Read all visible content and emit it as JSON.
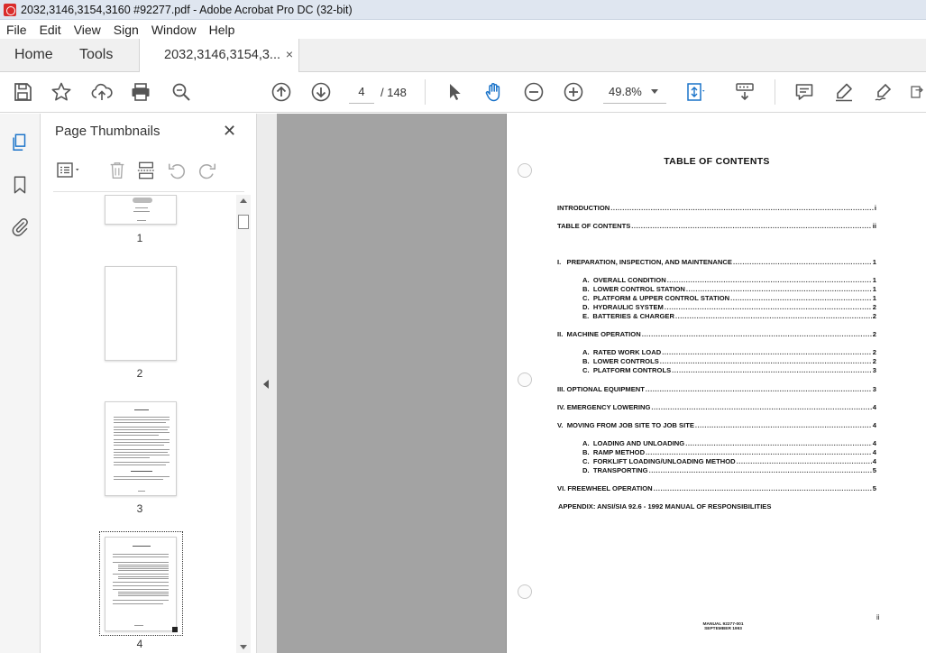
{
  "window": {
    "title": "2032,3146,3154,3160 #92277.pdf - Adobe Acrobat Pro DC (32-bit)"
  },
  "menu": [
    "File",
    "Edit",
    "View",
    "Sign",
    "Window",
    "Help"
  ],
  "tabs": {
    "home": "Home",
    "tools": "Tools",
    "document": "2032,3146,3154,3...",
    "close": "×"
  },
  "toolbar": {
    "current_page": "4",
    "page_total": "/ 148",
    "zoom": "49.8%",
    "icons": [
      "save-icon",
      "star-icon",
      "upload-icon",
      "print-icon",
      "zoom-search-icon",
      "page-up-icon",
      "page-down-icon",
      "select-cursor-icon",
      "hand-icon",
      "zoom-out-icon",
      "zoom-in-icon",
      "fit-page-icon",
      "keyboard-scroll-icon",
      "comment-icon",
      "highlight-pen-icon",
      "sign-icon",
      "more-tools-icon"
    ]
  },
  "left_rail": {
    "icons": [
      "page-thumbnails-icon",
      "bookmarks-icon",
      "attachments-icon"
    ]
  },
  "thumbnails_panel": {
    "title": "Page Thumbnails",
    "close": "✕",
    "pages": [
      "1",
      "2",
      "3",
      "4"
    ],
    "selected_page": "4"
  },
  "document": {
    "toc_title": "TABLE OF CONTENTS",
    "entries": [
      {
        "label": "INTRODUCTION",
        "page": "i"
      },
      {
        "label": "TABLE OF CONTENTS",
        "page": "ii"
      },
      {
        "label": "I.   PREPARATION, INSPECTION, AND MAINTENANCE",
        "page": "1"
      },
      {
        "label": "A.  OVERALL CONDITION",
        "page": "1"
      },
      {
        "label": "B.  LOWER CONTROL STATION",
        "page": "1"
      },
      {
        "label": "C.  PLATFORM & UPPER CONTROL STATION",
        "page": "1"
      },
      {
        "label": "D.  HYDRAULIC SYSTEM",
        "page": "2"
      },
      {
        "label": "E.  BATTERIES & CHARGER",
        "page": "2"
      },
      {
        "label": "II.  MACHINE OPERATION",
        "page": "2"
      },
      {
        "label": "A.  RATED WORK LOAD",
        "page": "2"
      },
      {
        "label": "B.  LOWER CONTROLS",
        "page": "2"
      },
      {
        "label": "C.  PLATFORM CONTROLS",
        "page": "3"
      },
      {
        "label": "III. OPTIONAL EQUIPMENT",
        "page": "3"
      },
      {
        "label": "IV. EMERGENCY LOWERING",
        "page": "4"
      },
      {
        "label": "V.  MOVING FROM JOB SITE TO JOB SITE",
        "page": "4"
      },
      {
        "label": "A.  LOADING AND UNLOADING",
        "page": "4"
      },
      {
        "label": "B.  RAMP METHOD",
        "page": "4"
      },
      {
        "label": "C.  FORKLIFT LOADING/UNLOADING METHOD",
        "page": "4"
      },
      {
        "label": "D.  TRANSPORTING",
        "page": "5"
      },
      {
        "label": "VI. FREEWHEEL OPERATION",
        "page": "5"
      }
    ],
    "appendix": "APPENDIX: ANSI/SIA 92.6 - 1992 MANUAL OF RESPONSIBILITIES",
    "footer_line1": "MANUAL 92277-001",
    "footer_line2": "SEPTEMBER 1993",
    "page_roman": "ii"
  }
}
